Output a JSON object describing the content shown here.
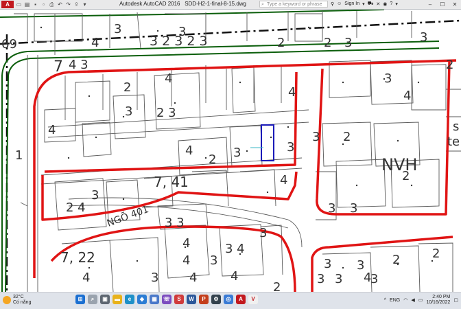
{
  "window": {
    "app_title": "Autodesk AutoCAD 2016",
    "file_name": "SDD-H2-1-final-8-15.dwg",
    "search_placeholder": "Type a keyword or phrase",
    "sign_in": "Sign In",
    "logo": "A"
  },
  "drawing": {
    "labels": {
      "l_69": "69",
      "l_3a": "3",
      "l_4a": "4",
      "l_3b": "3",
      "l_32323": "3 2 3 2 3",
      "l_2a": "2",
      "l_3c": "3",
      "l_2b": "2",
      "l_3d": "3",
      "l_7": "7",
      "l_43": "4 3",
      "l_2c": "2",
      "l_4b": "4",
      "l_4c": "4",
      "l_3e": "3",
      "l_4d": "4",
      "l_4e": "4",
      "l_3f": "3",
      "l_23": "2 3",
      "l_3g": "3",
      "l_4f": "4",
      "l_2d": "2",
      "l_3h": "3",
      "l_2e": "2",
      "l_3i": "3",
      "l_4g": "4",
      "l_nvh": "NVH",
      "l_2f": "2",
      "l_741": "7, 41",
      "l_3j": "3",
      "l_24": "2 4",
      "l_ngo": "NGÕ 401",
      "l_33": "3 3",
      "l_1": "1",
      "l_2g": "2",
      "l_4h": "4",
      "l_34": "3 4",
      "l_3k": "3",
      "l_4i": "4",
      "l_3l": "3",
      "l_722": "7, 22",
      "l_4j": "4",
      "l_3m": "3",
      "l_4k": "4",
      "l_4l": "4",
      "l_3n": "3",
      "l_3o": "3",
      "l_3p": "3",
      "l_2h": "2",
      "l_2i": "2",
      "l_3q": "3",
      "l_4m": "4",
      "l_3r": "3",
      "l_3s": "3",
      "l_3t": "3",
      "l_s": "s",
      "l_te": "te",
      "l_2j": "2"
    }
  },
  "taskbar": {
    "temp": "32°C",
    "condition": "Có nắng",
    "lang": "ENG",
    "time": "2:40 PM",
    "date": "10/16/2022"
  },
  "colors": {
    "road_red": "#e01414",
    "green_line": "#0b5e0b",
    "parcel": "#555555",
    "selection": "#1a1ab8"
  }
}
